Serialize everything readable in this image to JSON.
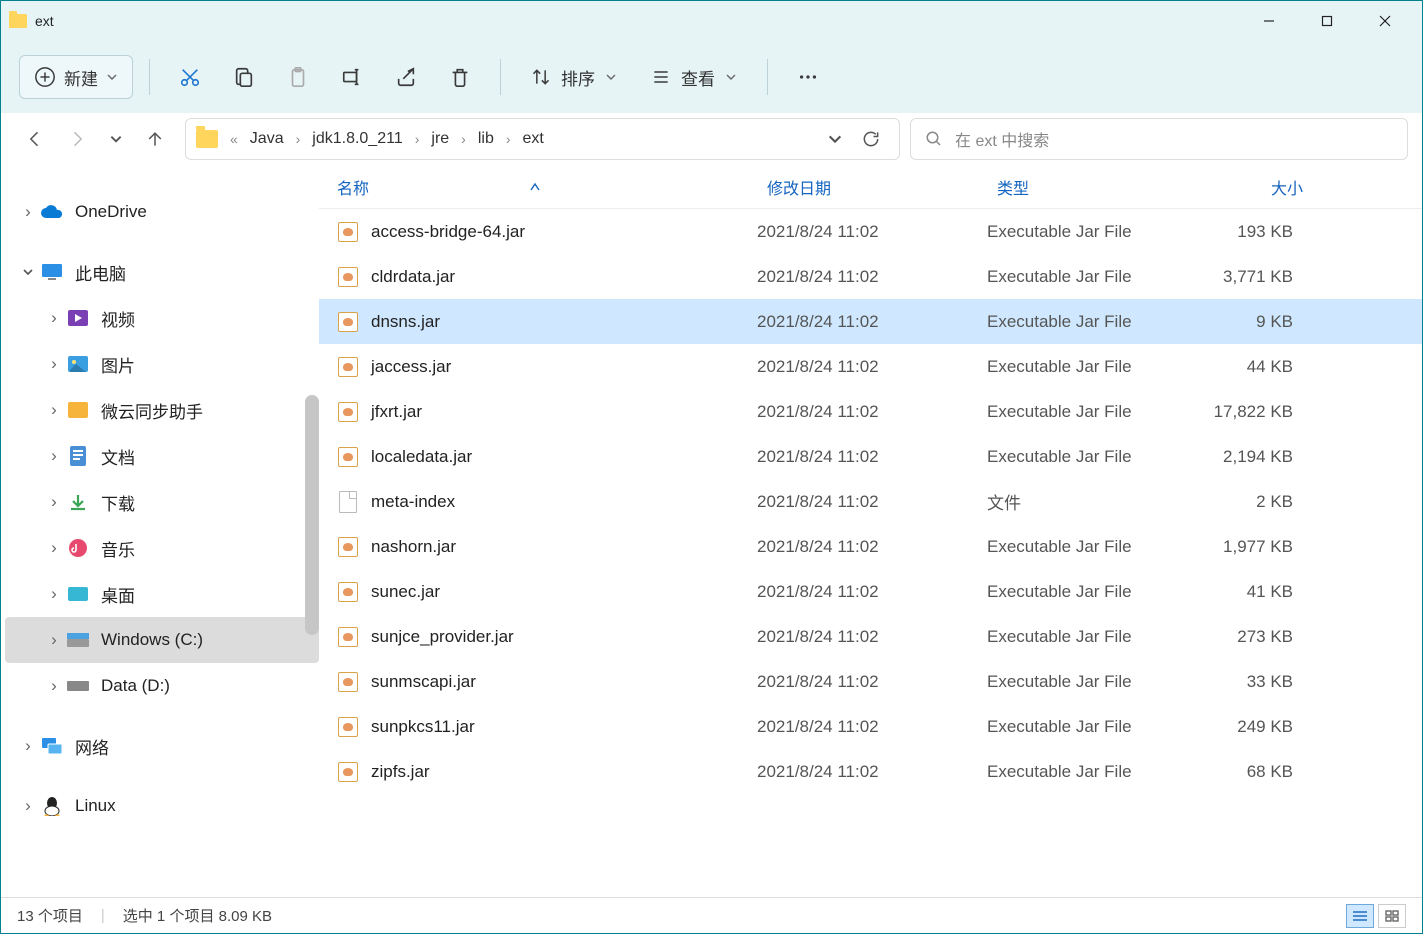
{
  "window": {
    "title": "ext"
  },
  "toolbar": {
    "new_label": "新建",
    "sort_label": "排序",
    "view_label": "查看"
  },
  "breadcrumb": {
    "overflow": "«",
    "segs": [
      "Java",
      "jdk1.8.0_211",
      "jre",
      "lib",
      "ext"
    ]
  },
  "search": {
    "placeholder": "在 ext 中搜索"
  },
  "sidebar": {
    "onedrive": "OneDrive",
    "thispc": "此电脑",
    "videos": "视频",
    "pictures": "图片",
    "weiyun": "微云同步助手",
    "documents": "文档",
    "downloads": "下载",
    "music": "音乐",
    "desktop": "桌面",
    "cdrive": "Windows (C:)",
    "ddrive": "Data (D:)",
    "network": "网络",
    "linux": "Linux"
  },
  "columns": {
    "name": "名称",
    "date": "修改日期",
    "type": "类型",
    "size": "大小"
  },
  "files": [
    {
      "name": "access-bridge-64.jar",
      "date": "2021/8/24 11:02",
      "type": "Executable Jar File",
      "size": "193 KB",
      "icon": "jar",
      "selected": false
    },
    {
      "name": "cldrdata.jar",
      "date": "2021/8/24 11:02",
      "type": "Executable Jar File",
      "size": "3,771 KB",
      "icon": "jar",
      "selected": false
    },
    {
      "name": "dnsns.jar",
      "date": "2021/8/24 11:02",
      "type": "Executable Jar File",
      "size": "9 KB",
      "icon": "jar",
      "selected": true
    },
    {
      "name": "jaccess.jar",
      "date": "2021/8/24 11:02",
      "type": "Executable Jar File",
      "size": "44 KB",
      "icon": "jar",
      "selected": false
    },
    {
      "name": "jfxrt.jar",
      "date": "2021/8/24 11:02",
      "type": "Executable Jar File",
      "size": "17,822 KB",
      "icon": "jar",
      "selected": false
    },
    {
      "name": "localedata.jar",
      "date": "2021/8/24 11:02",
      "type": "Executable Jar File",
      "size": "2,194 KB",
      "icon": "jar",
      "selected": false
    },
    {
      "name": "meta-index",
      "date": "2021/8/24 11:02",
      "type": "文件",
      "size": "2 KB",
      "icon": "file",
      "selected": false
    },
    {
      "name": "nashorn.jar",
      "date": "2021/8/24 11:02",
      "type": "Executable Jar File",
      "size": "1,977 KB",
      "icon": "jar",
      "selected": false
    },
    {
      "name": "sunec.jar",
      "date": "2021/8/24 11:02",
      "type": "Executable Jar File",
      "size": "41 KB",
      "icon": "jar",
      "selected": false
    },
    {
      "name": "sunjce_provider.jar",
      "date": "2021/8/24 11:02",
      "type": "Executable Jar File",
      "size": "273 KB",
      "icon": "jar",
      "selected": false
    },
    {
      "name": "sunmscapi.jar",
      "date": "2021/8/24 11:02",
      "type": "Executable Jar File",
      "size": "33 KB",
      "icon": "jar",
      "selected": false
    },
    {
      "name": "sunpkcs11.jar",
      "date": "2021/8/24 11:02",
      "type": "Executable Jar File",
      "size": "249 KB",
      "icon": "jar",
      "selected": false
    },
    {
      "name": "zipfs.jar",
      "date": "2021/8/24 11:02",
      "type": "Executable Jar File",
      "size": "68 KB",
      "icon": "jar",
      "selected": false
    }
  ],
  "status": {
    "items": "13 个项目",
    "selection": "选中 1 个项目",
    "selsize": "8.09 KB"
  }
}
